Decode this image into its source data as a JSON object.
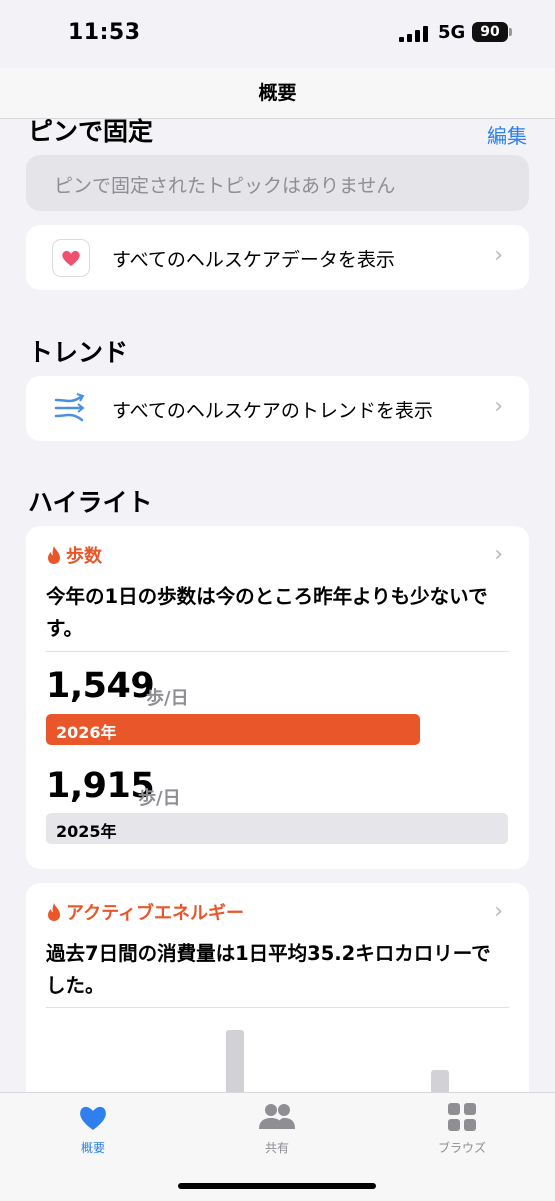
{
  "status_bar": {
    "time": "11:53",
    "network": "5G",
    "battery": "90"
  },
  "nav": {
    "title": "概要"
  },
  "pinned": {
    "title": "ピンで固定",
    "edit": "編集",
    "empty": "ピンで固定されたトピックはありません",
    "all_data": "すべてのヘルスケアデータを表示"
  },
  "trends": {
    "title": "トレンド",
    "all_trends": "すべてのヘルスケアのトレンドを表示"
  },
  "highlights": {
    "title": "ハイライト",
    "steps": {
      "category": "歩数",
      "summary": "今年の1日の歩数は今のところ昨年よりも少ないです。",
      "current": {
        "value": "1,549",
        "unit": "歩/日",
        "year": "2026年",
        "fill_ratio": 0.81,
        "color": "#e8562a"
      },
      "previous": {
        "value": "1,915",
        "unit": "歩/日",
        "year": "2025年",
        "fill_ratio": 1.0,
        "color": "#e5e5ea"
      }
    },
    "energy": {
      "category": "アクティブエネルギー",
      "summary": "過去7日間の消費量は1日平均35.2キロカロリーでした。"
    }
  },
  "tabs": [
    {
      "label": "概要",
      "icon": "heart-icon",
      "active": true
    },
    {
      "label": "共有",
      "icon": "people-icon",
      "active": false
    },
    {
      "label": "ブラウズ",
      "icon": "grid-icon",
      "active": false
    }
  ],
  "colors": {
    "accent": "#2f80ed",
    "highlight": "#e8562a",
    "background": "#f2f2f7"
  }
}
